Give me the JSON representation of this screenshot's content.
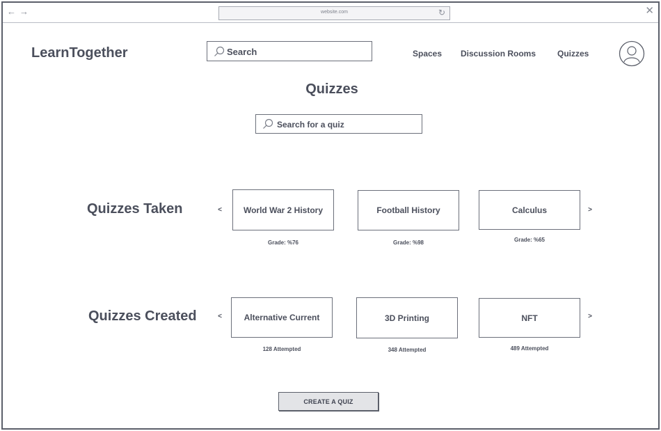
{
  "browser": {
    "url": "website.com",
    "back_glyph": "←",
    "forward_glyph": "→",
    "reload_glyph": "↻",
    "close_glyph": "✕"
  },
  "header": {
    "logo": "LearnTogether",
    "search_placeholder": "Search",
    "nav": {
      "spaces": "Spaces",
      "discussion_rooms": "Discussion Rooms",
      "quizzes": "Quizzes"
    }
  },
  "main": {
    "title": "Quizzes",
    "search_placeholder": "Search for a quiz",
    "prev_glyph": "<",
    "next_glyph": ">",
    "taken": {
      "title": "Quizzes Taken",
      "cards": [
        {
          "name": "World War 2 History",
          "sub": "Grade: %76"
        },
        {
          "name": "Football History",
          "sub": "Grade: %98"
        },
        {
          "name": "Calculus",
          "sub": "Grade: %65"
        }
      ]
    },
    "created": {
      "title": "Quizzes Created",
      "cards": [
        {
          "name": "Alternative Current",
          "sub": "128 Attempted"
        },
        {
          "name": "3D Printing",
          "sub": "348 Attempted"
        },
        {
          "name": "NFT",
          "sub": "489 Attempted"
        }
      ]
    },
    "create_button": "CREATE A QUIZ"
  },
  "colors": {
    "text": "#4b4f5c",
    "border": "#6b6f7a",
    "button_fill": "#e3e4e7"
  },
  "icons": {
    "search": "search-icon",
    "avatar": "user-avatar-icon",
    "prev": "chevron-left-icon",
    "next": "chevron-right-icon"
  }
}
